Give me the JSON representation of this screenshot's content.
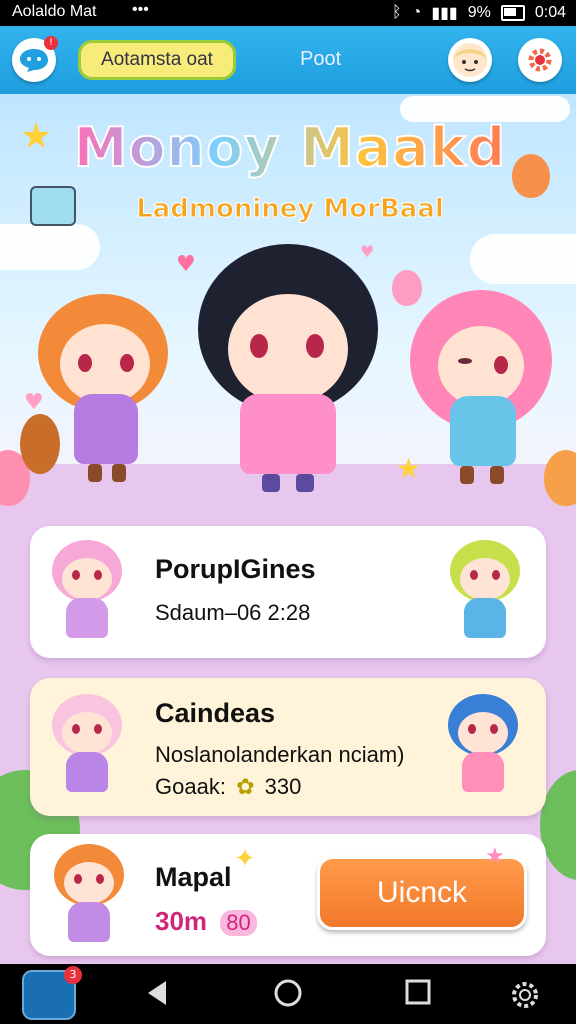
{
  "status_bar": {
    "app_label": "Aolaldo Mat",
    "dots": "•••",
    "signal": "9%",
    "time": "0:04"
  },
  "top_bar": {
    "notification_badge": "!",
    "title": "Aotamsta oat",
    "tab": "Poot"
  },
  "banner": {
    "title": "Monoy Maakd",
    "subtitle": "Ladmoniney MorBaal"
  },
  "cards": [
    {
      "title": "PorupIGines",
      "line1": "Sdaum–06 2:28"
    },
    {
      "title": "Caindeas",
      "line1": "Noslanolanderkan nciam)",
      "line2_label": "Goaak:",
      "line2_icon": "✿",
      "line2_value": "330"
    },
    {
      "title": "Mapal",
      "value": "30m",
      "chip": "80",
      "button": "Uicnck"
    }
  ],
  "nav_bar": {
    "app_badge": "3"
  },
  "colors": {
    "accent_blue": "#1f9ee0",
    "button_orange": "#f2782a",
    "pink": "#d0267a"
  }
}
